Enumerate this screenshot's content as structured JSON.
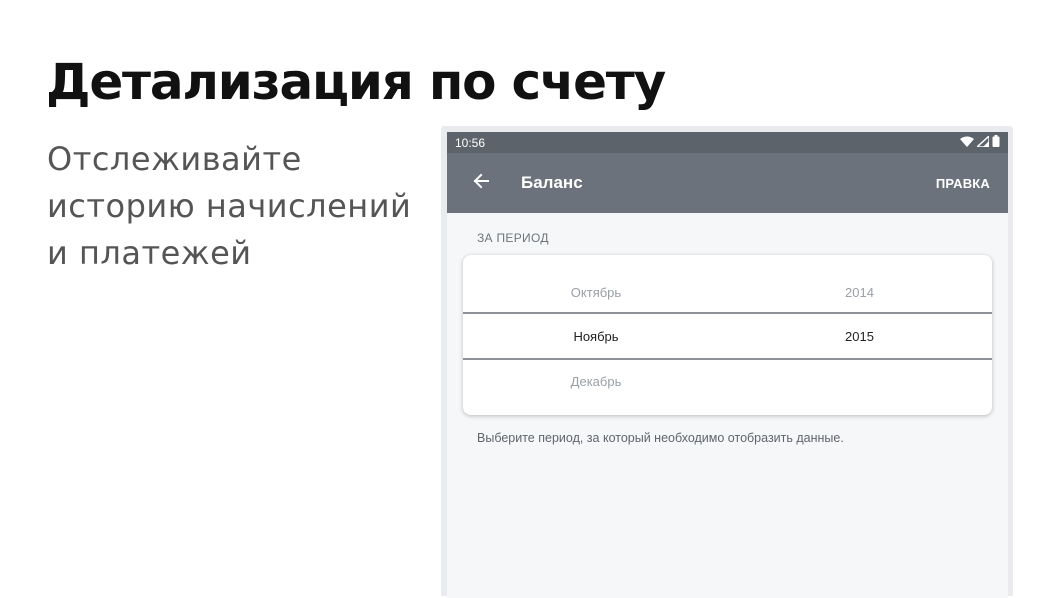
{
  "promo": {
    "title": "Детализация по счету",
    "subtitle_lines": [
      "Отслеживайте",
      "историю начислений",
      "и платежей"
    ]
  },
  "status_bar": {
    "time": "10:56",
    "icons": [
      "wifi-icon",
      "signal-icon",
      "battery-icon"
    ]
  },
  "app_bar": {
    "back_icon": "arrow-back-icon",
    "title": "Баланс",
    "action_label": "ПРАВКА"
  },
  "period": {
    "section_label": "ЗА ПЕРИОД",
    "months": [
      "Октябрь",
      "Ноябрь",
      "Декабрь"
    ],
    "years": [
      "2014",
      "2015",
      ""
    ],
    "selected_month": "Ноябрь",
    "selected_year": "2015",
    "hint": "Выберите период, за который необходимо отобразить данные."
  },
  "colors": {
    "status_bar": "#5c636b",
    "app_bar": "#6b727b",
    "screen_background": "#f6f7f9"
  }
}
